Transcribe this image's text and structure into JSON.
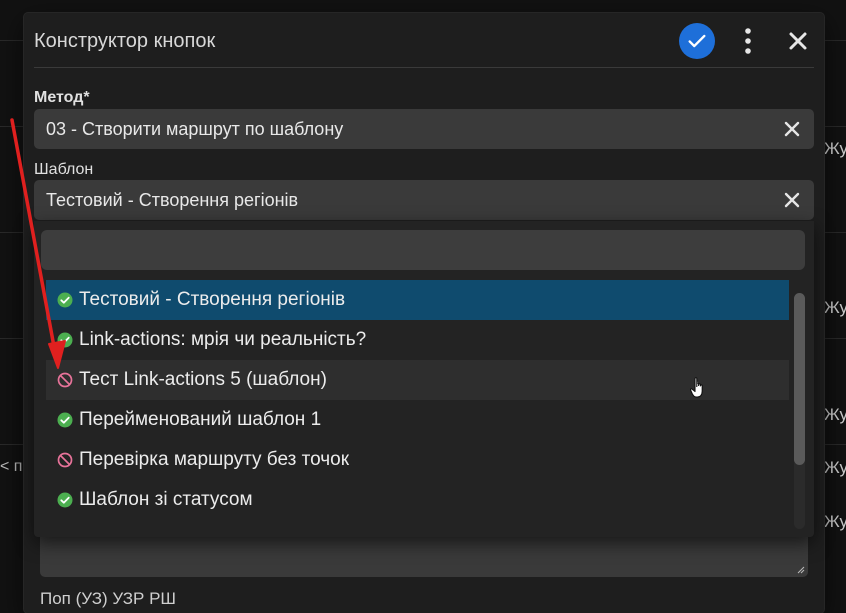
{
  "dialog": {
    "title": "Конструктор кнопок",
    "method_label": "Метод*",
    "method_value": "03 - Створити маршрут по шаблону",
    "template_label": "Шаблон",
    "template_value": "Тестовий - Створення регіонів",
    "below_text": "Поп           (УЗ) УЗР РШ"
  },
  "dropdown": {
    "search_value": "",
    "options": [
      {
        "label": "Тестовий - Створення регіонів",
        "status": "active",
        "state": "selected"
      },
      {
        "label": "Link-actions: мрія чи реальність?",
        "status": "active",
        "state": ""
      },
      {
        "label": "Тест Link-actions 5 (шаблон)",
        "status": "blocked",
        "state": "hover"
      },
      {
        "label": "Перейменований шаблон 1",
        "status": "active",
        "state": ""
      },
      {
        "label": "Перевірка маршруту без точок",
        "status": "blocked",
        "state": ""
      },
      {
        "label": "Шаблон зі статусом",
        "status": "active",
        "state": ""
      }
    ]
  },
  "background": {
    "right_labels": [
      "Жу",
      "Жу",
      "Жу",
      "Жу",
      "Жу"
    ],
    "left_label": "< по"
  },
  "icons": {
    "confirm": "check-icon",
    "more": "more-vert-icon",
    "close": "close-icon",
    "clear": "clear-icon",
    "active": "check-circle-icon",
    "blocked": "block-icon"
  },
  "colors": {
    "accent": "#1e6fd9",
    "selected": "#0f4b6e",
    "active_icon": "#4caf50",
    "blocked_icon": "#e8739a",
    "arrow": "#e0201f"
  }
}
